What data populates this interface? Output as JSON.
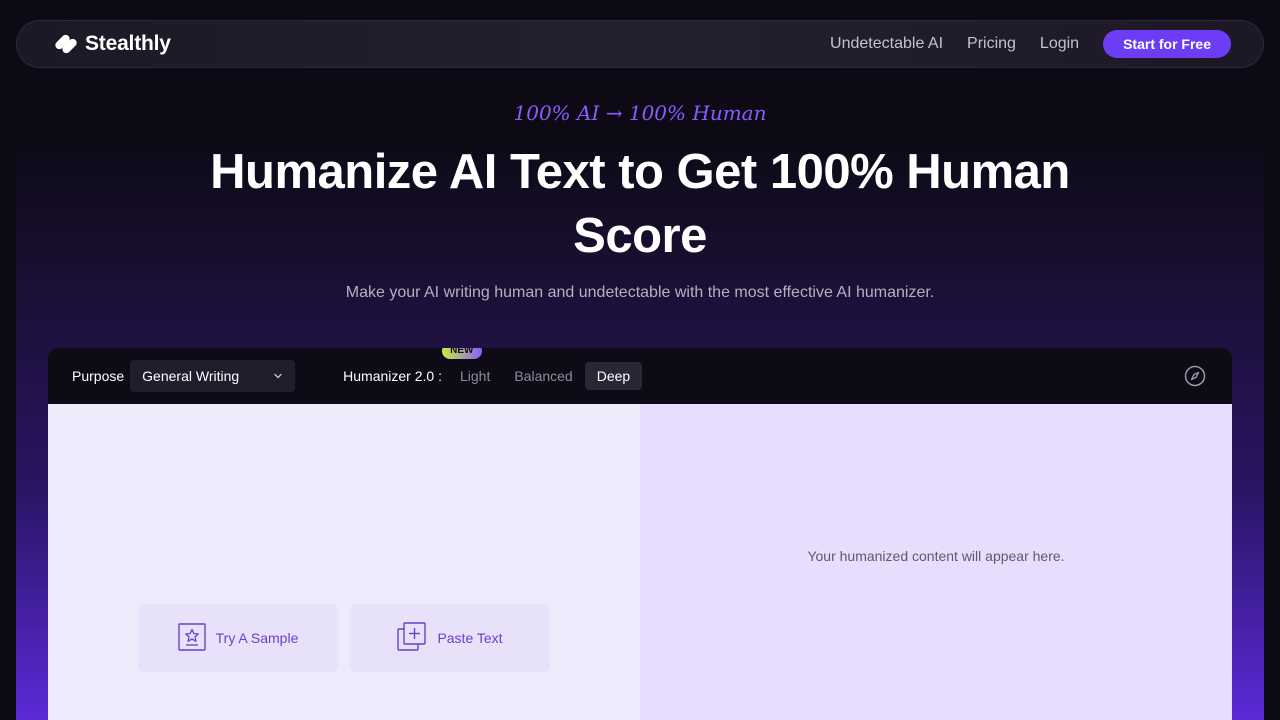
{
  "nav": {
    "brand": "Stealthly",
    "links": [
      "Undetectable AI",
      "Pricing",
      "Login"
    ],
    "cta": "Start for Free"
  },
  "hero": {
    "tagline": "100% AI → 100% Human",
    "headline": "Humanize AI Text to Get 100% Human Score",
    "subline": "Make your AI writing human and undetectable with the most effective AI humanizer."
  },
  "toolbar": {
    "purpose_label": "Purpose",
    "purpose_value": "General Writing",
    "humanizer_label": "Humanizer 2.0 :",
    "badge": "NEW",
    "modes": [
      "Light",
      "Balanced",
      "Deep"
    ],
    "active_mode": "Deep"
  },
  "editor": {
    "sample_button": "Try A Sample",
    "paste_button": "Paste Text",
    "output_placeholder": "Your humanized content will appear here."
  },
  "colors": {
    "accent": "#6d3cf5",
    "tagline": "#8a5cff",
    "input_bg": "#efebfd",
    "output_bg": "#e6defc"
  },
  "icons": [
    "stealthly-logo-icon",
    "chevron-down-icon",
    "compass-icon",
    "sample-icon",
    "paste-icon"
  ]
}
